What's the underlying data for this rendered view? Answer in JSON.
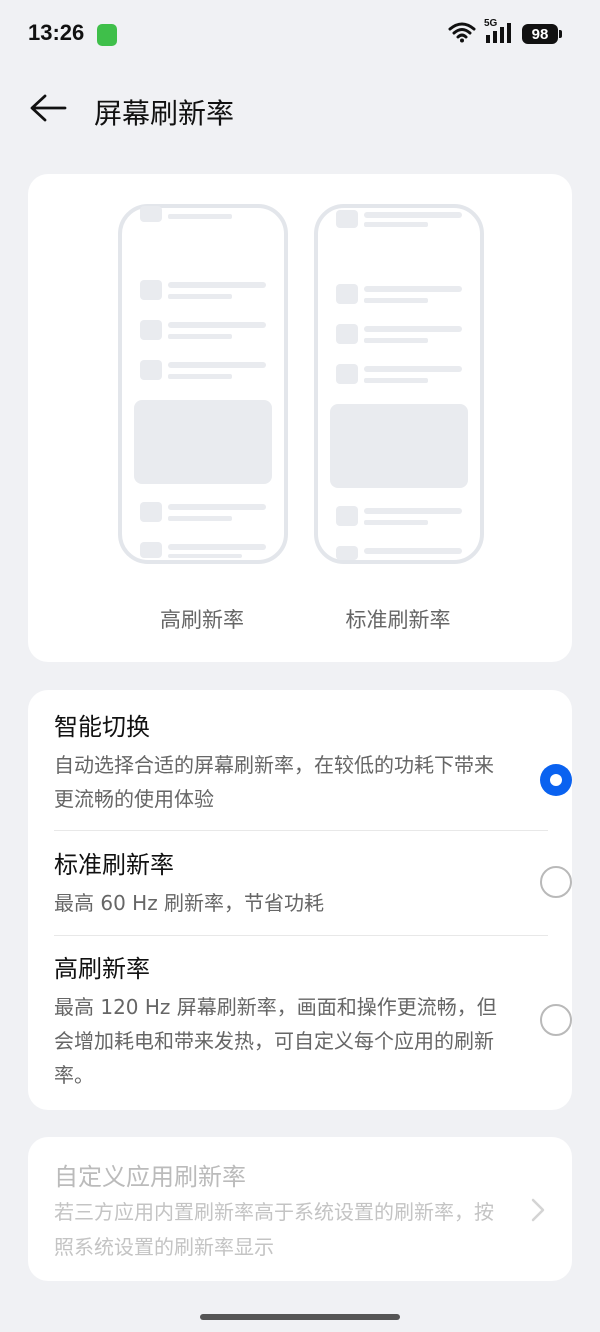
{
  "status_bar": {
    "time": "13:26",
    "network": "5G",
    "battery": "98",
    "icons": [
      "wifi-icon",
      "signal-icon",
      "battery-icon"
    ]
  },
  "header": {
    "back_icon": "arrow-left-icon",
    "title": "屏幕刷新率"
  },
  "preview": {
    "labels": [
      "高刷新率",
      "标准刷新率"
    ]
  },
  "options": [
    {
      "title": "智能切换",
      "description": "自动选择合适的屏幕刷新率，在较低的功耗下带来更流畅的使用体验",
      "selected": true
    },
    {
      "title": "标准刷新率",
      "description": "最高 60 Hz 刷新率，节省功耗",
      "selected": false
    },
    {
      "title": "高刷新率",
      "description": "最高 120 Hz 屏幕刷新率，画面和操作更流畅，但会增加耗电和带来发热，可自定义每个应用的刷新率。",
      "selected": false
    }
  ],
  "custom": {
    "title": "自定义应用刷新率",
    "description": "若三方应用内置刷新率高于系统设置的刷新率，按照系统设置的刷新率显示",
    "icon": "chevron-right-icon"
  },
  "colors": {
    "accent": "#0a62f0",
    "background": "#f0f1f4",
    "card": "#ffffff",
    "disabled_text": "#bbbbbb"
  }
}
